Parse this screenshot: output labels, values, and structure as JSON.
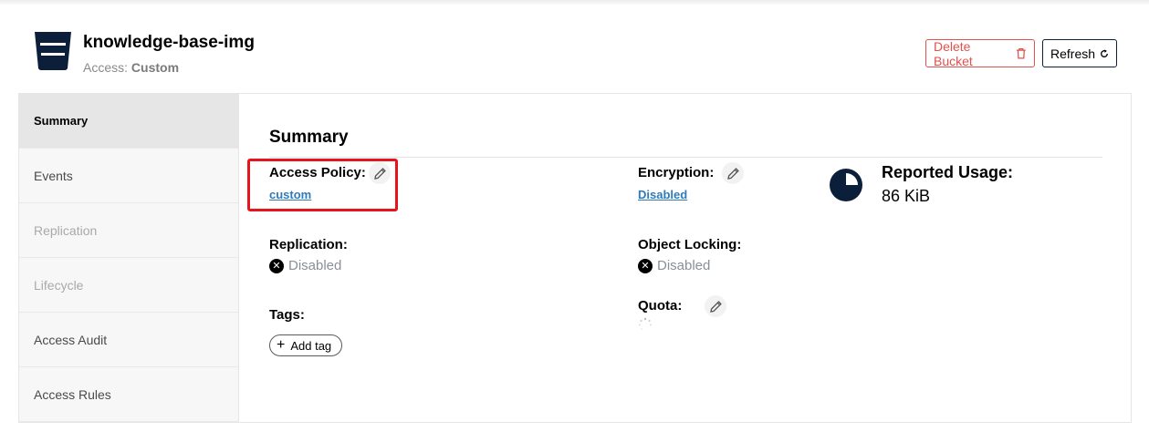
{
  "header": {
    "bucket_name": "knowledge-base-img",
    "access_label": "Access:",
    "access_value": "Custom",
    "delete_button": "Delete Bucket",
    "refresh_button": "Refresh"
  },
  "sidebar": {
    "items": [
      {
        "label": "Summary",
        "state": "active"
      },
      {
        "label": "Events",
        "state": "enabled"
      },
      {
        "label": "Replication",
        "state": "disabled"
      },
      {
        "label": "Lifecycle",
        "state": "disabled"
      },
      {
        "label": "Access Audit",
        "state": "enabled"
      },
      {
        "label": "Access Rules",
        "state": "enabled"
      }
    ]
  },
  "summary": {
    "title": "Summary",
    "access_policy": {
      "label": "Access Policy:",
      "value": "custom"
    },
    "encryption": {
      "label": "Encryption:",
      "value": "Disabled"
    },
    "replication": {
      "label": "Replication:",
      "value": "Disabled"
    },
    "object_locking": {
      "label": "Object Locking:",
      "value": "Disabled"
    },
    "quota": {
      "label": "Quota:"
    },
    "tags": {
      "label": "Tags:",
      "add_button": "Add tag"
    },
    "reported_usage": {
      "label": "Reported Usage:",
      "value": "86 KiB"
    }
  },
  "colors": {
    "brand_navy": "#0b1f3a",
    "danger": "#e0524d",
    "link": "#2f7ab8",
    "highlight_box": "#e8141c"
  },
  "icons": [
    "bucket-icon",
    "trash-icon",
    "refresh-icon",
    "pencil-icon",
    "x-circle-icon",
    "pie-chart-icon",
    "plus-icon",
    "loading-spinner-icon"
  ]
}
